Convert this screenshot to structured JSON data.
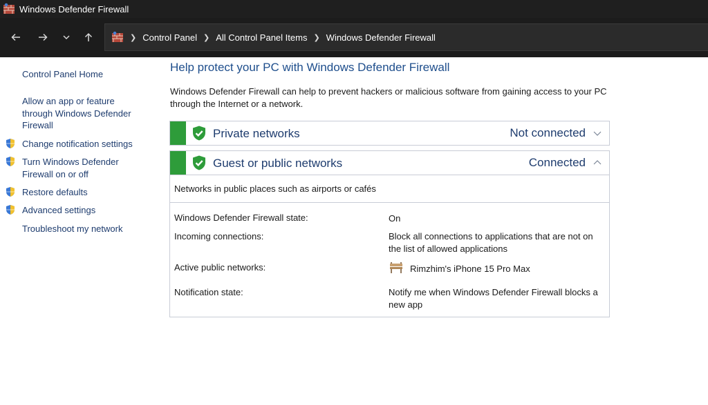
{
  "window": {
    "title": "Windows Defender Firewall"
  },
  "address": {
    "breadcrumbs": [
      "Control Panel",
      "All Control Panel Items",
      "Windows Defender Firewall"
    ]
  },
  "sidebar": {
    "items": [
      {
        "label": "Control Panel Home",
        "shield": false
      },
      {
        "label": "Allow an app or feature through Windows Defender Firewall",
        "shield": false
      },
      {
        "label": "Change notification settings",
        "shield": true
      },
      {
        "label": "Turn Windows Defender Firewall on or off",
        "shield": true
      },
      {
        "label": "Restore defaults",
        "shield": true
      },
      {
        "label": "Advanced settings",
        "shield": true
      },
      {
        "label": "Troubleshoot my network",
        "shield": false
      }
    ]
  },
  "main": {
    "heading": "Help protect your PC with Windows Defender Firewall",
    "intro": "Windows Defender Firewall can help to prevent hackers or malicious software from gaining access to your PC through the Internet or a network.",
    "private": {
      "name": "Private networks",
      "status": "Not connected",
      "expanded": false
    },
    "public": {
      "name": "Guest or public networks",
      "status": "Connected",
      "expanded": true,
      "description": "Networks in public places such as airports or cafés",
      "details": {
        "state_label": "Windows Defender Firewall state:",
        "state_value": "On",
        "incoming_label": "Incoming connections:",
        "incoming_value": "Block all connections to applications that are not on the list of allowed applications",
        "active_label": "Active public networks:",
        "active_value": "Rimzhim's iPhone 15 Pro Max",
        "notify_label": "Notification state:",
        "notify_value": "Notify me when Windows Defender Firewall blocks a new app"
      }
    }
  },
  "colors": {
    "link": "#1e3c6e",
    "heading": "#1e4e8c",
    "status_green": "#2e9c3a",
    "titlebar": "#1f1f1f"
  },
  "icons": {
    "app": "firewall-brick-icon",
    "back": "back-arrow-icon",
    "forward": "forward-arrow-icon",
    "recent": "chevron-down-icon",
    "up": "up-arrow-icon",
    "uac": "uac-shield-icon",
    "network_shield": "green-check-shield-icon",
    "network": "bench-network-icon"
  }
}
